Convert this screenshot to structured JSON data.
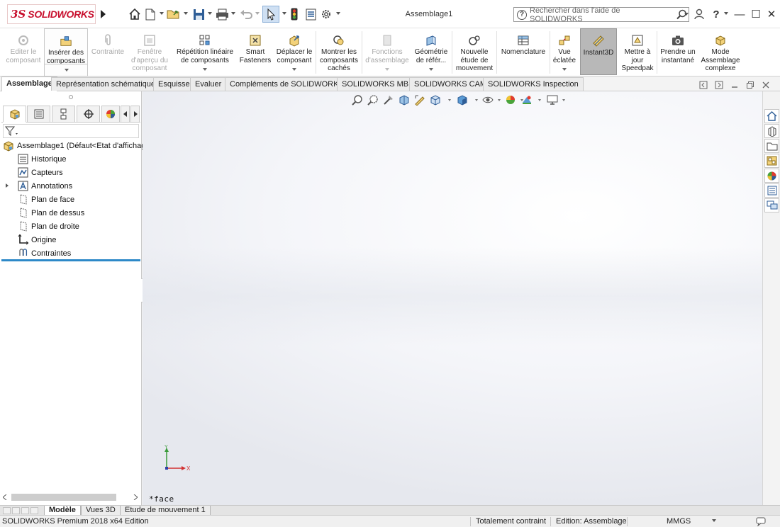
{
  "app": {
    "logo_prefix": "3S",
    "logo_text": "SOLIDWORKS",
    "document_title": "Assemblage1"
  },
  "search": {
    "help_glyph": "?",
    "placeholder": "Rechercher dans l'aide de SOLIDWORKS"
  },
  "window": {
    "minimize": "—",
    "maximize": "☐",
    "close": "✕",
    "help": "?"
  },
  "ribbon": {
    "edit_component": "Editer le composant",
    "insert_components": "Insérer des composants",
    "mate": "Contrainte",
    "preview_window": "Fenêtre d'aperçu du composant",
    "linear_pattern": "Répétition linéaire de composants",
    "smart_fasteners": "Smart Fasteners",
    "move_component": "Déplacer le composant",
    "show_hidden": "Montrer les composants cachés",
    "assembly_features": "Fonctions d'assemblage",
    "reference_geometry": "Géométrie de référ...",
    "new_motion_study": "Nouvelle étude de mouvement",
    "bom": "Nomenclature",
    "exploded_view": "Vue éclatée",
    "instant3d": "Instant3D",
    "update_speedpak": "Mettre à jour Speedpak",
    "snapshot": "Prendre un instantané",
    "large_assembly": "Mode Assemblage complexe"
  },
  "command_tabs": [
    "Assemblage",
    "Représentation schématique",
    "Esquisse",
    "Evaluer",
    "Compléments de SOLIDWORKS",
    "SOLIDWORKS MBD",
    "SOLIDWORKS CAM",
    "SOLIDWORKS Inspection"
  ],
  "tree": {
    "root": "Assemblage1  (Défaut<Etat d'affichag",
    "items": [
      "Historique",
      "Capteurs",
      "Annotations",
      "Plan de face",
      "Plan de dessus",
      "Plan de droite",
      "Origine",
      "Contraintes"
    ]
  },
  "viewport": {
    "view_label": "*face",
    "axis_x": "X",
    "axis_y": "Y"
  },
  "bottom_tabs": [
    "Modèle",
    "Vues 3D",
    "Etude de mouvement 1"
  ],
  "status": {
    "product": "SOLIDWORKS Premium 2018 x64 Edition",
    "constraint": "Totalement contraint",
    "mode": "Edition: Assemblage",
    "units": "MMGS"
  },
  "colors": {
    "brand": "#c8102e",
    "selection_blue": "#2d89c8",
    "active_button": "#b8b8b8"
  }
}
